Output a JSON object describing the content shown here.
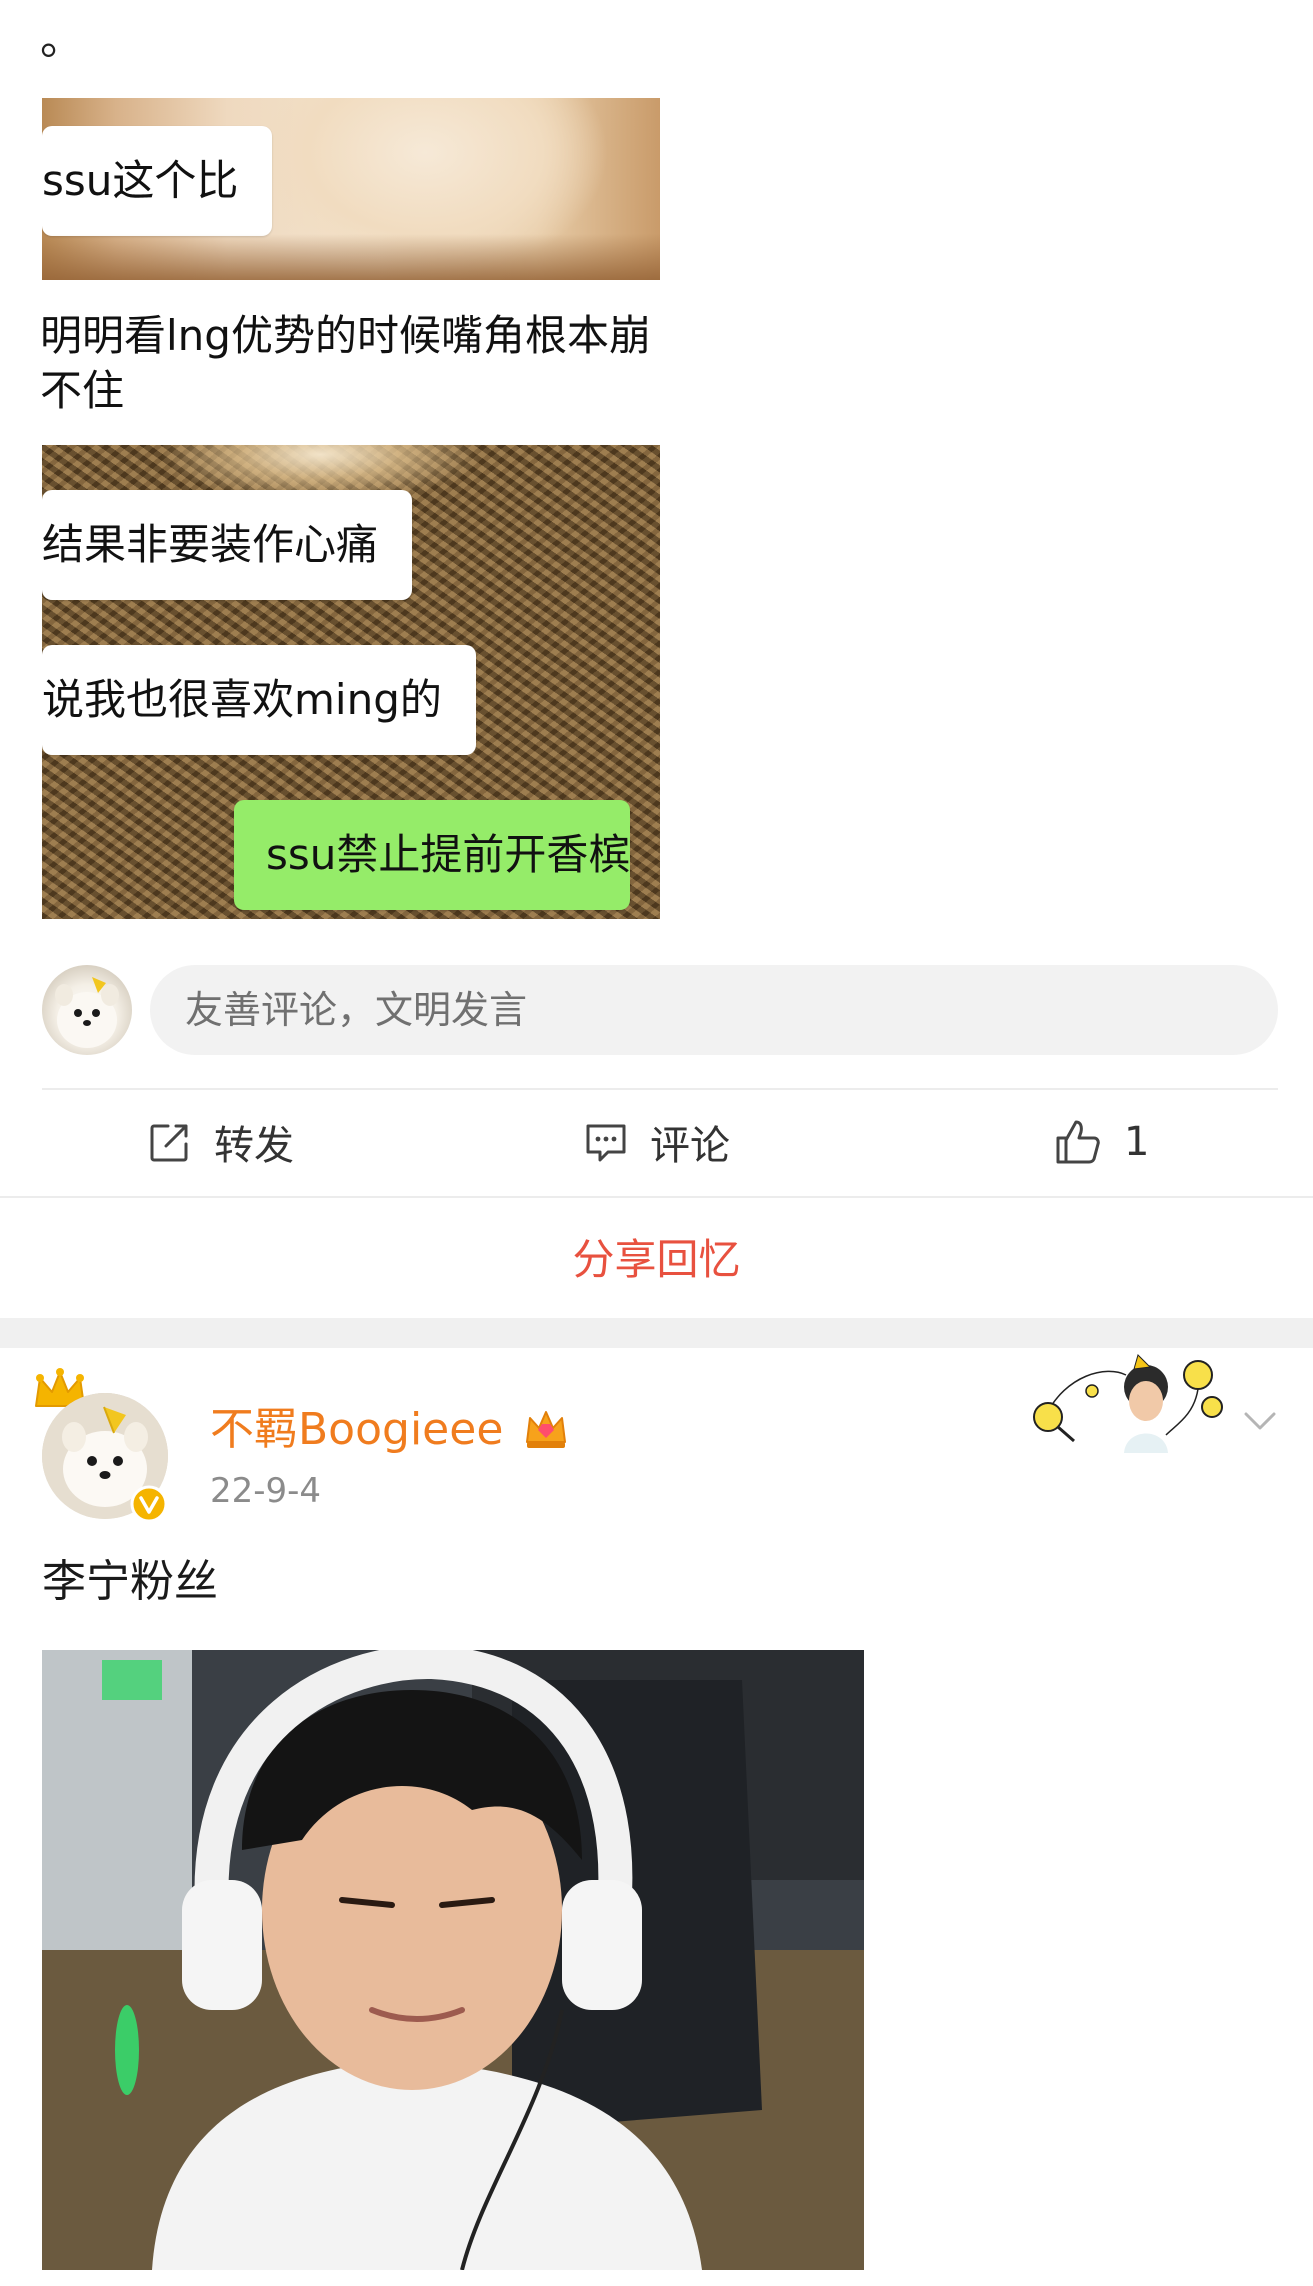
{
  "post1": {
    "trailing_text": "。",
    "chat": {
      "bubble_1": "ssu这个比",
      "caption": "明明看lng优势的时候嘴角根本崩不住",
      "bubble_2": "结果非要装作心痛",
      "bubble_3": "说我也很喜欢ming的",
      "bubble_4": "ssu禁止提前开香槟"
    },
    "comment_placeholder": "友善评论，文明发言",
    "actions": {
      "repost_label": "转发",
      "comment_label": "评论",
      "like_count": "1"
    },
    "share_memory": "分享回忆"
  },
  "post2": {
    "username": "不羁Boogieee",
    "timestamp": "22-9-4",
    "text": "李宁粉丝"
  },
  "colors": {
    "username": "#f07c1e",
    "share_memory": "#e8513f",
    "chat_green": "#95ec69",
    "verified_badge": "#f5b400"
  },
  "icons": {
    "repost": "repost-icon",
    "comment": "comment-icon",
    "like": "thumbs-up-icon",
    "crown": "crown-icon",
    "vip": "vip-crown-icon",
    "verified": "verified-badge-icon",
    "more": "chevron-down-icon"
  }
}
